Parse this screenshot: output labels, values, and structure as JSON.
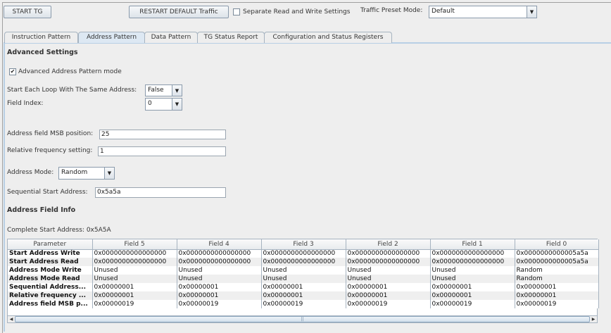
{
  "toolbar": {
    "start_label": "START TG",
    "restart_label": "RESTART DEFAULT Traffic",
    "separate_label": "Separate Read and Write Settings",
    "separate_checked": false,
    "preset_label": "Traffic Preset Mode:",
    "preset_value": "Default"
  },
  "tabs": [
    {
      "label": "Instruction Pattern"
    },
    {
      "label": "Address Pattern",
      "selected": true
    },
    {
      "label": "Data Pattern"
    },
    {
      "label": "TG Status Report"
    },
    {
      "label": "Configuration and Status Registers"
    }
  ],
  "advanced": {
    "title": "Advanced Settings",
    "mode_label": "Advanced Address Pattern mode",
    "mode_checked": true,
    "same_addr_label": "Start Each Loop With The Same Address:",
    "same_addr_value": "False",
    "field_index_label": "Field Index:",
    "field_index_value": "0",
    "msb_label": "Address field MSB position:",
    "msb_value": "25",
    "freq_label": "Relative frequency setting:",
    "freq_value": "1",
    "mode_select_label": "Address Mode:",
    "mode_select_value": "Random",
    "seq_label": "Sequential Start Address:",
    "seq_value": "0x5a5a"
  },
  "field_info": {
    "title": "Address Field Info",
    "complete_label": "Complete Start Address: 0x5A5A",
    "columns": [
      "Parameter",
      "Field 5",
      "Field 4",
      "Field 3",
      "Field 2",
      "Field 1",
      "Field 0"
    ],
    "rows": [
      [
        "Start Address Write",
        "0x0000000000000000",
        "0x0000000000000000",
        "0x0000000000000000",
        "0x0000000000000000",
        "0x0000000000000000",
        "0x0000000000005a5a"
      ],
      [
        "Start Address Read",
        "0x0000000000000000",
        "0x0000000000000000",
        "0x0000000000000000",
        "0x0000000000000000",
        "0x0000000000000000",
        "0x0000000000005a5a"
      ],
      [
        "Address Mode Write",
        "Unused",
        "Unused",
        "Unused",
        "Unused",
        "Unused",
        "Random"
      ],
      [
        "Address Mode Read",
        "Unused",
        "Unused",
        "Unused",
        "Unused",
        "Unused",
        "Random"
      ],
      [
        "Sequential Address...",
        "0x00000001",
        "0x00000001",
        "0x00000001",
        "0x00000001",
        "0x00000001",
        "0x00000001"
      ],
      [
        "Relative frequency ...",
        "0x00000001",
        "0x00000001",
        "0x00000001",
        "0x00000001",
        "0x00000001",
        "0x00000001"
      ],
      [
        "Address field MSB p...",
        "0x00000019",
        "0x00000019",
        "0x00000019",
        "0x00000019",
        "0x00000019",
        "0x00000019"
      ]
    ]
  }
}
